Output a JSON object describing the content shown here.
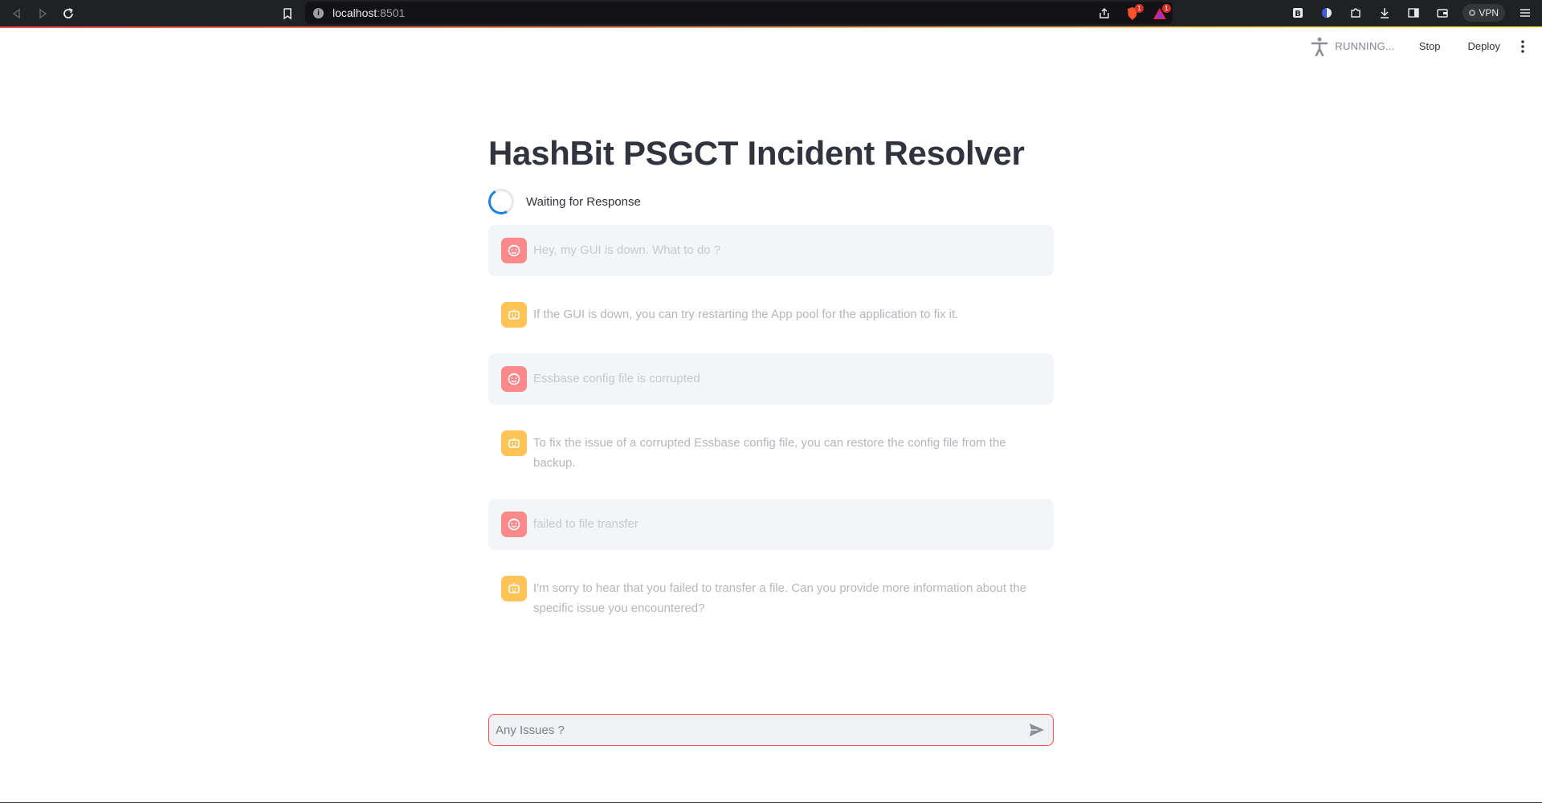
{
  "browser": {
    "url_host": "localhost",
    "url_port": ":8501",
    "extension_badges": [
      "1",
      "1"
    ],
    "vpn_label": "VPN"
  },
  "header": {
    "status": "RUNNING...",
    "stop_label": "Stop",
    "deploy_label": "Deploy"
  },
  "main": {
    "title": "HashBit PSGCT Incident Resolver",
    "status_text": "Waiting for Response"
  },
  "messages": [
    {
      "role": "user",
      "text": "Hey, my GUI is down. What to do ?"
    },
    {
      "role": "assistant",
      "text": "If the GUI is down, you can try restarting the App pool for the application to fix it."
    },
    {
      "role": "user",
      "text": "Essbase config file is corrupted"
    },
    {
      "role": "assistant",
      "text": "To fix the issue of a corrupted Essbase config file, you can restore the config file from the backup."
    },
    {
      "role": "user",
      "text": "failed to file transfer"
    },
    {
      "role": "assistant",
      "text": "I'm sorry to hear that you failed to transfer a file. Can you provide more information about the specific issue you encountered?"
    }
  ],
  "chat_input": {
    "placeholder": "Any Issues ?",
    "value": ""
  },
  "colors": {
    "accent": "#ff4b4b",
    "user_avatar": "#ff4b4b",
    "assistant_avatar": "#ffbd45",
    "spinner": "#1c83e1"
  }
}
